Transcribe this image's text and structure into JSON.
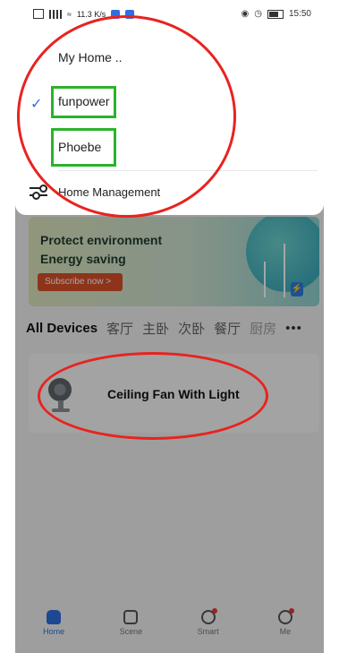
{
  "status_bar": {
    "network_speed": "11.3 K/s",
    "time": "15:50",
    "icons": [
      "sim-icon",
      "signal-icon",
      "wifi-icon",
      "app-notification-icon",
      "app-notification-icon",
      "eye-icon",
      "alarm-icon",
      "battery-icon"
    ]
  },
  "home_menu": {
    "title": "My Home ..",
    "homes": [
      {
        "label": "funpower",
        "selected": true
      },
      {
        "label": "Phoebe",
        "selected": false
      }
    ],
    "management_label": "Home Management",
    "check_icon": "checkmark-icon",
    "management_icon": "sliders-icon"
  },
  "banner": {
    "line1": "Protect environment",
    "line2": "Energy saving",
    "button": "Subscribe now >"
  },
  "tabs": {
    "active": "All Devices",
    "items": [
      "客厅",
      "主卧",
      "次卧",
      "餐厅",
      "厨房"
    ],
    "more": "•••"
  },
  "devices": [
    {
      "name": "Ceiling Fan With Light",
      "icon": "fan-icon"
    }
  ],
  "bottom_nav": [
    {
      "label": "Home",
      "icon": "home-icon",
      "active": true
    },
    {
      "label": "Scene",
      "icon": "scene-icon",
      "active": false
    },
    {
      "label": "Smart",
      "icon": "smart-icon",
      "active": false,
      "badge": true
    },
    {
      "label": "Me",
      "icon": "profile-icon",
      "active": false,
      "badge": true
    }
  ],
  "colors": {
    "accent": "#2f6fe1",
    "annotation_green": "#2bb32b",
    "annotation_red": "#e8231f",
    "banner_button": "#d9512a"
  }
}
